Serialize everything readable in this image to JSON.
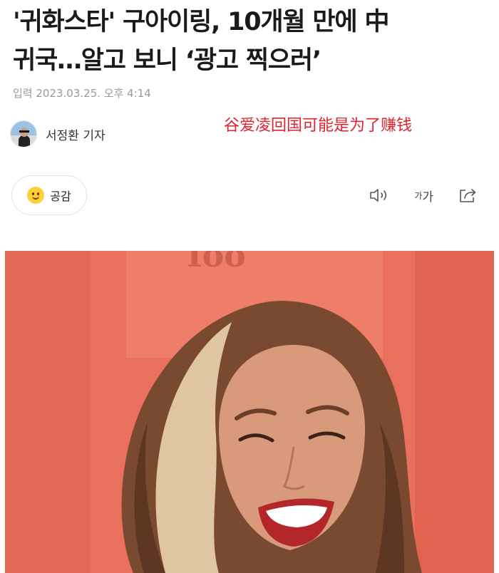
{
  "article": {
    "headline_line1": "'귀화스타' 구아이링, 10개월 만에 中",
    "headline_line2": "귀국…알고 보니 ‘광고 찍으러’",
    "dateline": "입력 2023.03.25. 오후 4:14",
    "reporter": "서정환 기자"
  },
  "annotation": {
    "text": "谷爱凌回国可能是为了赚钱",
    "color": "#e0232f"
  },
  "toolbar": {
    "like_label": "공감",
    "font_size_label_small": "가",
    "font_size_label_large": "가",
    "icons": [
      "smiley-icon",
      "speaker-icon",
      "share-icon"
    ]
  },
  "colors": {
    "photo_background": "#e86a55"
  }
}
